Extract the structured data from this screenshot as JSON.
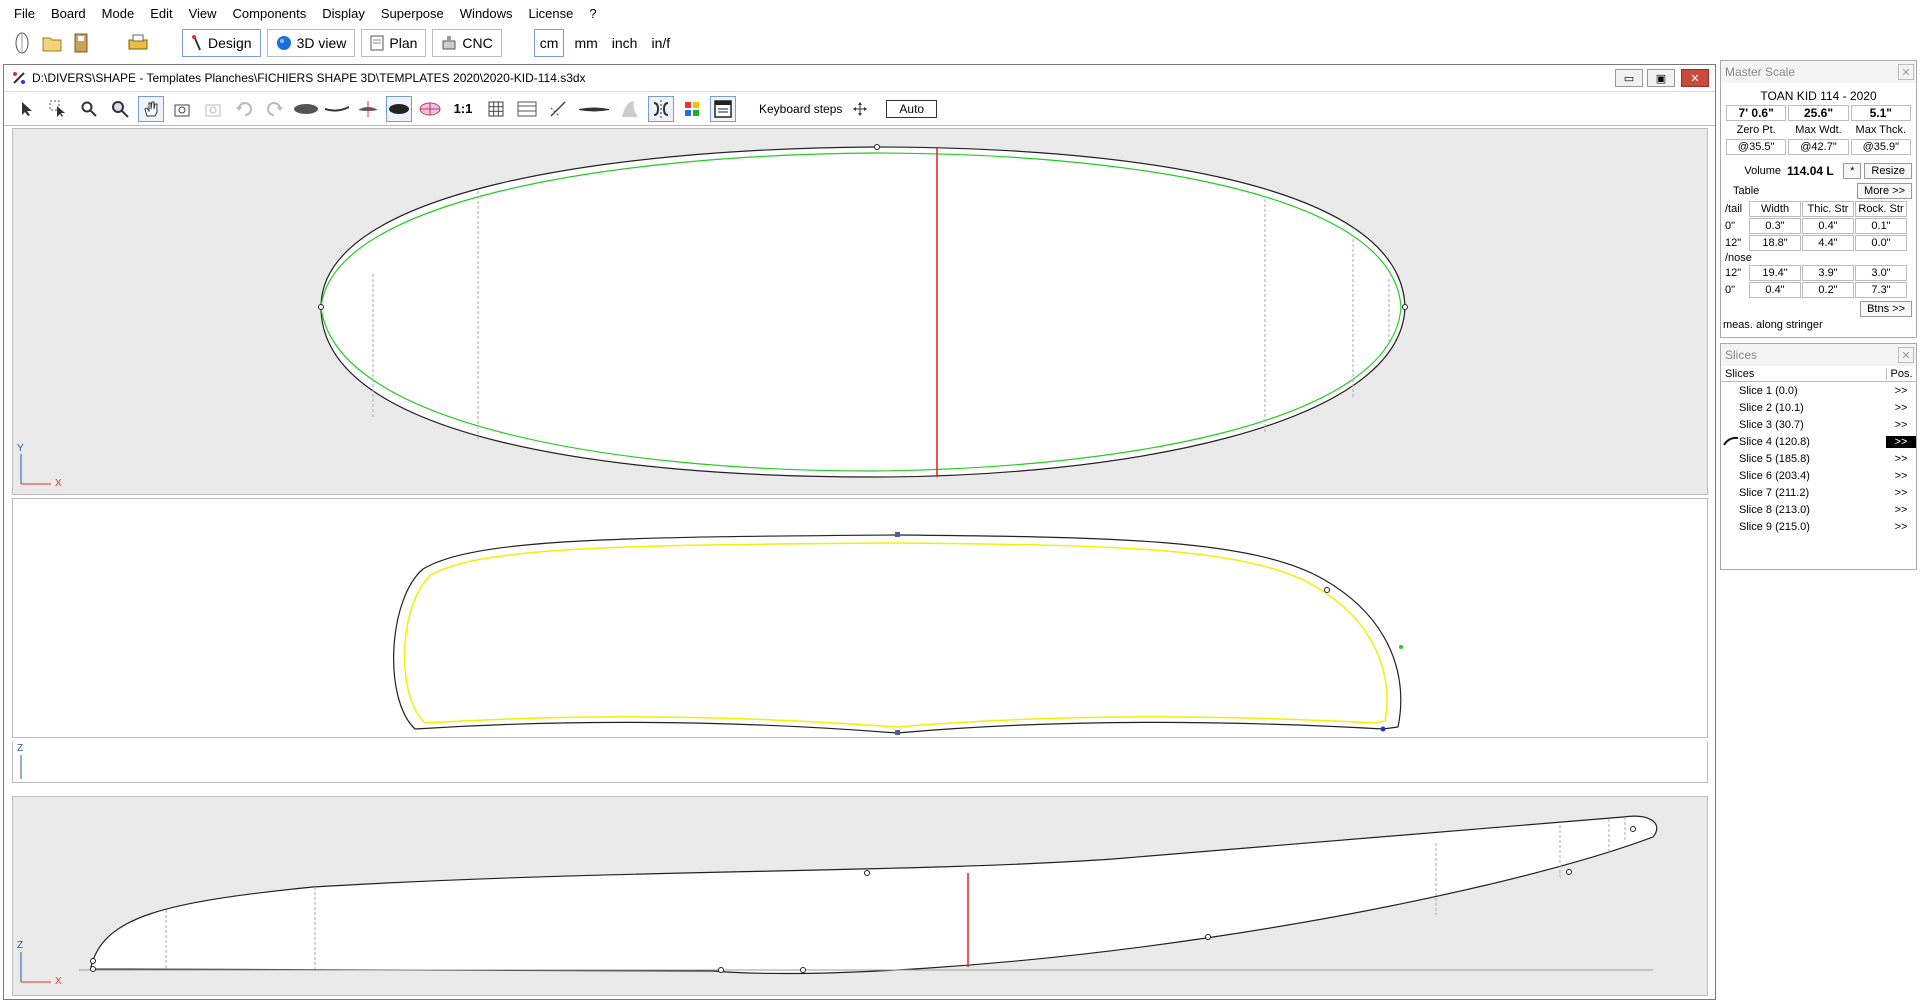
{
  "menu": [
    "File",
    "Board",
    "Mode",
    "Edit",
    "View",
    "Components",
    "Display",
    "Superpose",
    "Windows",
    "License",
    "?"
  ],
  "modes": {
    "design": "Design",
    "view3d": "3D view",
    "plan": "Plan",
    "cnc": "CNC"
  },
  "units": [
    "cm",
    "mm",
    "inch",
    "in/f"
  ],
  "doc": {
    "path": "D:\\DIVERS\\SHAPE - Templates Planches\\FICHIERS SHAPE 3D\\TEMPLATES 2020\\2020-KID-114.s3dx",
    "scale_label": "1:1",
    "keyboard_steps": "Keyboard steps",
    "auto": "Auto"
  },
  "axes": {
    "top_y": "Y",
    "top_x": "X",
    "slice_z": "Z",
    "side_z": "Z",
    "side_x": "X"
  },
  "master": {
    "title": "Master Scale",
    "board": "TOAN KID 114 - 2020",
    "length": "7' 0.6\"",
    "width": "25.6\"",
    "thickness": "5.1\"",
    "zero_lbl": "Zero Pt.",
    "maxw_lbl": "Max Wdt.",
    "maxt_lbl": "Max Thck.",
    "zero_val": "@35.5\"",
    "maxw_val": "@42.7\"",
    "maxt_val": "@35.9\"",
    "volume_lbl": "Volume",
    "volume_val": "114.04 L",
    "star": "*",
    "resize": "Resize",
    "table_lbl": "Table",
    "more": "More >>",
    "tail_lbl": "/tail",
    "nose_lbl": "/nose",
    "col_width": "Width",
    "col_thic": "Thic. Str",
    "col_rock": "Rock. Str",
    "tail_rows": [
      {
        "pos": "0\"",
        "w": "0.3\"",
        "t": "0.4\"",
        "r": "0.1\""
      },
      {
        "pos": "12\"",
        "w": "18.8\"",
        "t": "4.4\"",
        "r": "0.0\""
      }
    ],
    "nose_rows": [
      {
        "pos": "12\"",
        "w": "19.4\"",
        "t": "3.9\"",
        "r": "3.0\""
      },
      {
        "pos": "0\"",
        "w": "0.4\"",
        "t": "0.2\"",
        "r": "7.3\""
      }
    ],
    "btns": "Btns >>",
    "meas": "meas. along stringer"
  },
  "slices": {
    "title": "Slices",
    "col_name": "Slices",
    "col_pos": "Pos.",
    "items": [
      {
        "name": "Slice 1 (0.0)",
        "pos": ">>"
      },
      {
        "name": "Slice 2 (10.1)",
        "pos": ">>"
      },
      {
        "name": "Slice 3 (30.7)",
        "pos": ">>"
      },
      {
        "name": "Slice 4 (120.8)",
        "pos": ">>"
      },
      {
        "name": "Slice 5 (185.8)",
        "pos": ">>"
      },
      {
        "name": "Slice 6 (203.4)",
        "pos": ">>"
      },
      {
        "name": "Slice 7 (211.2)",
        "pos": ">>"
      },
      {
        "name": "Slice 8 (213.0)",
        "pos": ">>"
      },
      {
        "name": "Slice 9 (215.0)",
        "pos": ">>"
      }
    ]
  },
  "colors": {
    "accent": "#7a9cd3",
    "outline_green": "#22cc22",
    "slice_yellow": "#f0f000",
    "stringer_red": "#e02020"
  }
}
